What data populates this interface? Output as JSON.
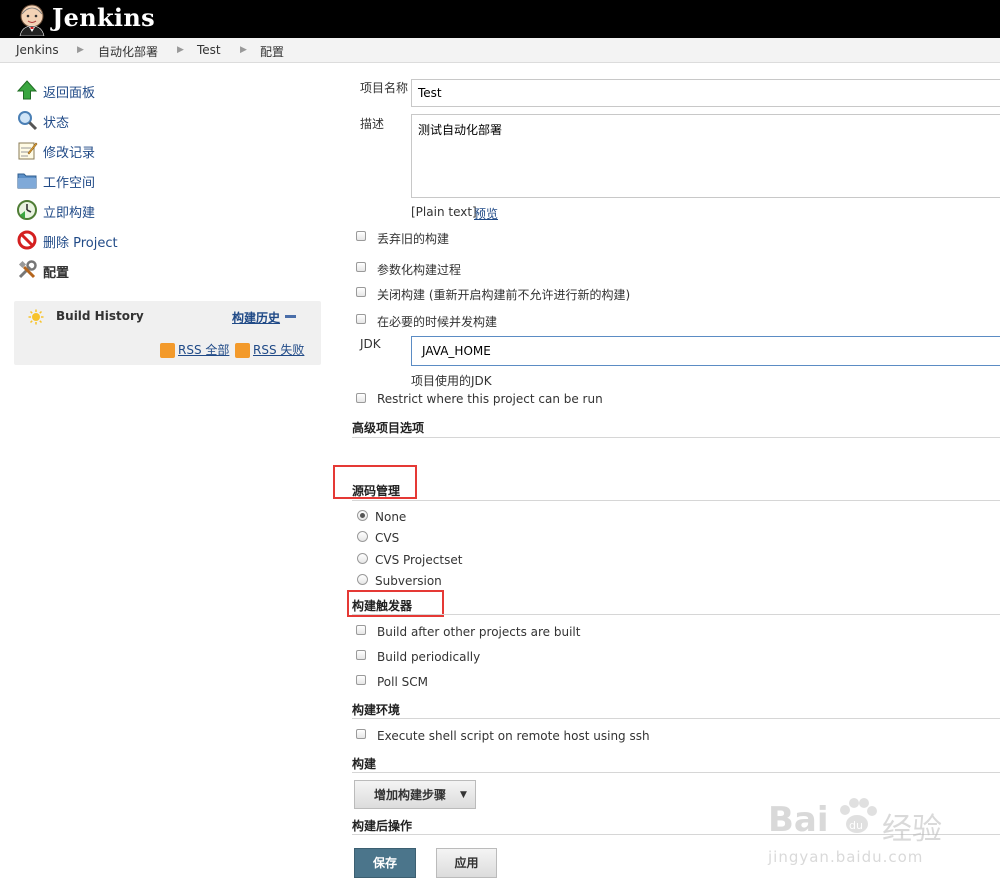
{
  "app": {
    "title": "Jenkins"
  },
  "breadcrumb": [
    "Jenkins",
    "自动化部署",
    "Test",
    "配置"
  ],
  "sidebar": {
    "items": [
      {
        "label": "返回面板",
        "icon": "up-arrow-icon"
      },
      {
        "label": "状态",
        "icon": "magnifier-icon"
      },
      {
        "label": "修改记录",
        "icon": "notepad-icon"
      },
      {
        "label": "工作空间",
        "icon": "folder-icon"
      },
      {
        "label": "立即构建",
        "icon": "clock-icon"
      },
      {
        "label": "删除 Project",
        "icon": "no-entry-icon"
      },
      {
        "label": "配置",
        "icon": "tools-icon"
      }
    ]
  },
  "build_history": {
    "title": "Build History",
    "link": "构建历史",
    "rss_all": "RSS 全部",
    "rss_failed": "RSS 失败"
  },
  "form": {
    "project_name_label": "项目名称",
    "project_name_value": "Test",
    "description_label": "描述",
    "description_value": "测试自动化部署",
    "plain_text": "[Plain text]",
    "preview": "预览",
    "checkboxes_top": [
      "丢弃旧的构建",
      "参数化构建过程",
      "关闭构建 (重新开启构建前不允许进行新的构建)",
      "在必要的时候并发构建"
    ],
    "jdk_label": "JDK",
    "jdk_value": "JAVA_HOME",
    "jdk_help": "项目使用的JDK",
    "restrict_label": "Restrict where this project can be run"
  },
  "sections": {
    "advanced": "高级项目选项",
    "scm": "源码管理",
    "scm_options": [
      {
        "label": "None",
        "checked": true
      },
      {
        "label": "CVS",
        "checked": false
      },
      {
        "label": "CVS Projectset",
        "checked": false
      },
      {
        "label": "Subversion",
        "checked": false
      }
    ],
    "triggers": "构建触发器",
    "trigger_options": [
      "Build after other projects are built",
      "Build periodically",
      "Poll SCM"
    ],
    "env": "构建环境",
    "env_options": [
      "Execute shell script on remote host using ssh"
    ],
    "build": "构建",
    "add_step": "增加构建步骤",
    "post_build": "构建后操作"
  },
  "buttons": {
    "save": "保存",
    "apply": "应用"
  },
  "watermark": {
    "brand": "Bai",
    "brand_cn": "经验",
    "url": "jingyan.baidu.com"
  },
  "colors": {
    "header": "#000000",
    "link": "#204a87",
    "save_button": "#4b758b",
    "highlight": "#e53935"
  }
}
